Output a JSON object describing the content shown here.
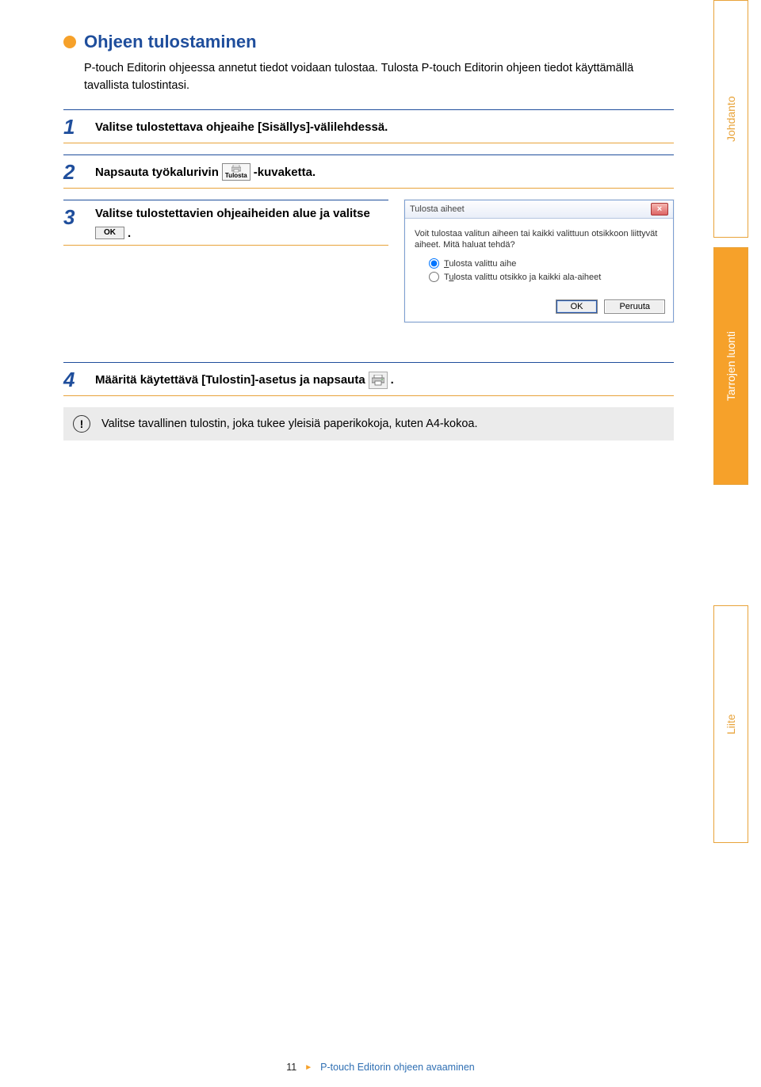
{
  "heading": "Ohjeen tulostaminen",
  "intro": "P-touch Editorin ohjeessa annetut tiedot voidaan tulostaa. Tulosta P-touch Editorin ohjeen tiedot käyttämällä tavallista tulostintasi.",
  "steps": {
    "s1": {
      "num": "1",
      "text": "Valitse tulostettava ohjeaihe [Sisällys]-välilehdessä."
    },
    "s2": {
      "num": "2",
      "before": "Napsauta työkalurivin",
      "icon_label": "Tulosta",
      "after": "-kuvaketta."
    },
    "s3": {
      "num": "3",
      "before": "Valitse tulostettavien ohjeaiheiden alue ja valitse",
      "button": "OK",
      "after": "."
    },
    "s4": {
      "num": "4",
      "before": "Määritä käytettävä [Tulostin]-asetus ja napsauta",
      "after": "."
    }
  },
  "dialog": {
    "title": "Tulosta aiheet",
    "body": "Voit tulostaa valitun aiheen tai kaikki valittuun otsikkoon liittyvät aiheet. Mitä haluat tehdä?",
    "opt1_u": "T",
    "opt1_rest": "ulosta valittu aihe",
    "opt2_before": "T",
    "opt2_u": "u",
    "opt2_rest": "losta valittu otsikko ja kaikki ala-aiheet",
    "ok": "OK",
    "cancel": "Peruuta",
    "close": "×"
  },
  "note": {
    "mark": "!",
    "text": "Valitse tavallinen tulostin, joka tukee yleisiä paperikokoja, kuten A4-kokoa."
  },
  "tabs": {
    "t1": "Johdanto",
    "t2": "Tarrojen luonti",
    "t3": "Liite"
  },
  "footer": {
    "page": "11",
    "arrow": "►",
    "link": "P-touch Editorin ohjeen avaaminen"
  }
}
